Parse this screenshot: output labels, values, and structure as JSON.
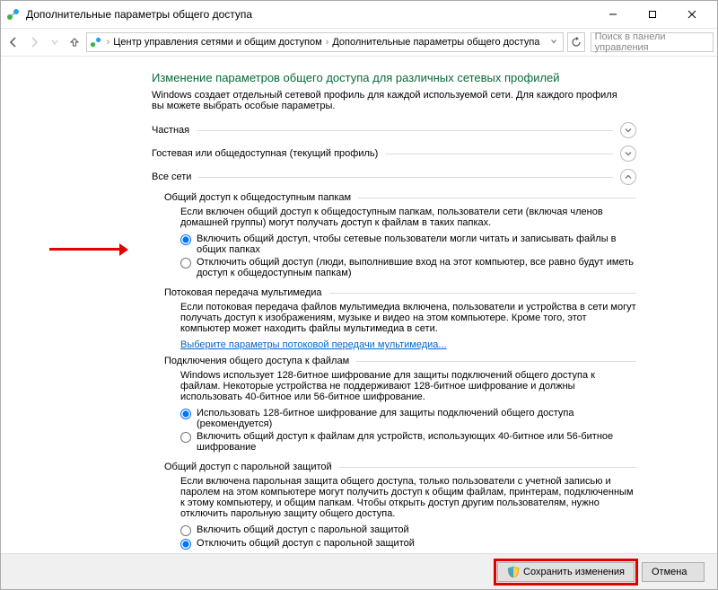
{
  "window": {
    "title": "Дополнительные параметры общего доступа"
  },
  "breadcrumb": {
    "root": "Центр управления сетями и общим доступом",
    "current": "Дополнительные параметры общего доступа"
  },
  "search": {
    "placeholder": "Поиск в панели управления"
  },
  "heading": "Изменение параметров общего доступа для различных сетевых профилей",
  "intro": "Windows создает отдельный сетевой профиль для каждой используемой сети. Для каждого профиля вы можете выбрать особые параметры.",
  "groups": {
    "private": {
      "title": "Частная"
    },
    "guest": {
      "title": "Гостевая или общедоступная (текущий профиль)"
    },
    "all": {
      "title": "Все сети"
    }
  },
  "public_folders": {
    "title": "Общий доступ к общедоступным папкам",
    "desc": "Если включен общий доступ к общедоступным папкам, пользователи сети (включая членов домашней группы) могут получать доступ к файлам в таких папках.",
    "opt_on": "Включить общий доступ, чтобы сетевые пользователи могли читать и записывать файлы в общих папках",
    "opt_off": "Отключить общий доступ (люди, выполнившие вход на этот компьютер, все равно будут иметь доступ к общедоступным папкам)"
  },
  "media": {
    "title": "Потоковая передача мультимедиа",
    "desc": "Если потоковая передача файлов мультимедиа включена, пользователи и устройства в сети могут получать доступ к изображениям, музыке и видео на этом компьютере. Кроме того, этот компьютер может находить файлы мультимедиа в сети.",
    "link": "Выберите параметры потоковой передачи мультимедиа..."
  },
  "file_conn": {
    "title": "Подключения общего доступа к файлам",
    "desc": "Windows использует 128-битное шифрование для защиты подключений общего доступа к файлам. Некоторые устройства не поддерживают 128-битное шифрование и должны использовать 40-битное или 56-битное шифрование.",
    "opt_128": "Использовать 128-битное шифрование для защиты подключений общего доступа (рекомендуется)",
    "opt_4056": "Включить общий доступ к файлам для устройств, использующих 40-битное или 56-битное шифрование"
  },
  "password": {
    "title": "Общий доступ с парольной защитой",
    "desc": "Если включена парольная защита общего доступа, только пользователи с учетной записью и паролем на этом компьютере могут получить доступ к общим файлам, принтерам, подключенным к этому компьютеру, и общим папкам. Чтобы открыть доступ другим пользователям, нужно отключить парольную защиту общего доступа.",
    "opt_on": "Включить общий доступ с парольной защитой",
    "opt_off": "Отключить общий доступ с парольной защитой"
  },
  "buttons": {
    "save": "Сохранить изменения",
    "cancel": "Отмена"
  }
}
